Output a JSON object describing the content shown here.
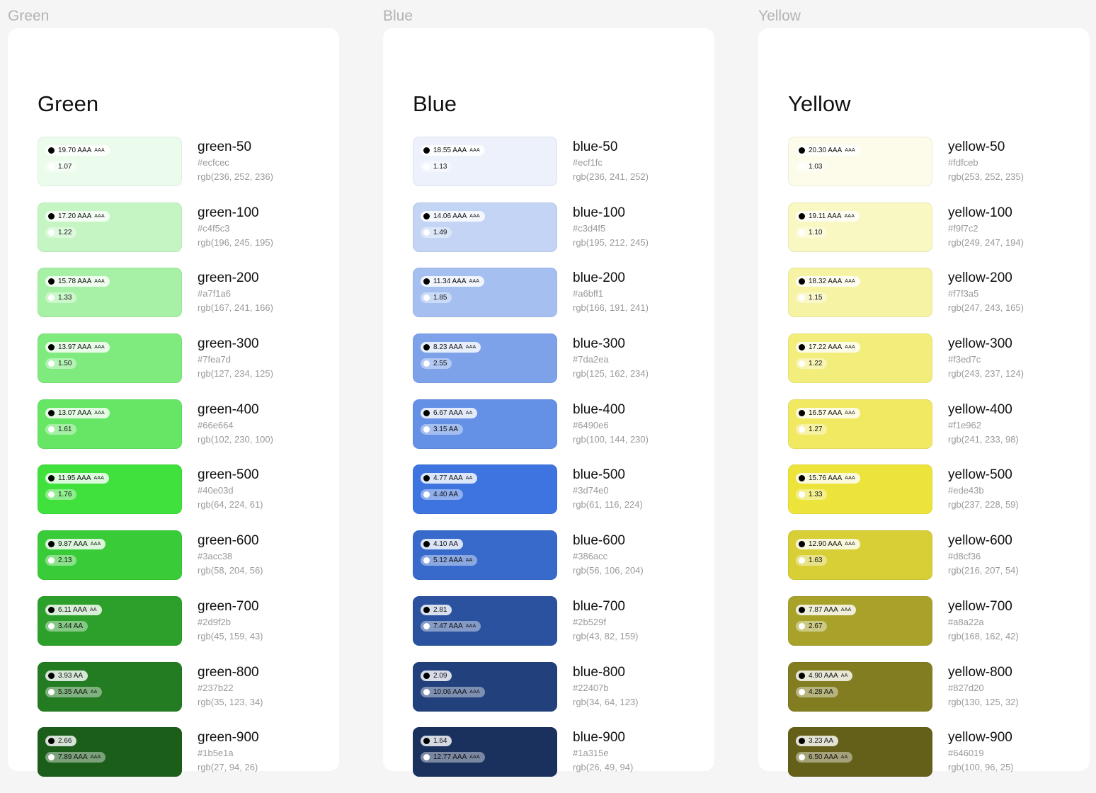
{
  "palettes": [
    {
      "frame_label": "Green",
      "title": "Green",
      "swatches": [
        {
          "name": "green-50",
          "hex": "#ecfcec",
          "rgb": "rgb(236, 252, 236)",
          "dark_ratio": "19.70 AAA",
          "dark_grade": "AAA",
          "light_ratio": "1.07",
          "light_grade": ""
        },
        {
          "name": "green-100",
          "hex": "#c4f5c3",
          "rgb": "rgb(196, 245, 195)",
          "dark_ratio": "17.20 AAA",
          "dark_grade": "AAA",
          "light_ratio": "1.22",
          "light_grade": ""
        },
        {
          "name": "green-200",
          "hex": "#a7f1a6",
          "rgb": "rgb(167, 241, 166)",
          "dark_ratio": "15.78 AAA",
          "dark_grade": "AAA",
          "light_ratio": "1.33",
          "light_grade": ""
        },
        {
          "name": "green-300",
          "hex": "#7fea7d",
          "rgb": "rgb(127, 234, 125)",
          "dark_ratio": "13.97 AAA",
          "dark_grade": "AAA",
          "light_ratio": "1.50",
          "light_grade": ""
        },
        {
          "name": "green-400",
          "hex": "#66e664",
          "rgb": "rgb(102, 230, 100)",
          "dark_ratio": "13.07 AAA",
          "dark_grade": "AAA",
          "light_ratio": "1.61",
          "light_grade": ""
        },
        {
          "name": "green-500",
          "hex": "#40e03d",
          "rgb": "rgb(64, 224, 61)",
          "dark_ratio": "11.95 AAA",
          "dark_grade": "AAA",
          "light_ratio": "1.76",
          "light_grade": ""
        },
        {
          "name": "green-600",
          "hex": "#3acc38",
          "rgb": "rgb(58, 204, 56)",
          "dark_ratio": "9.87 AAA",
          "dark_grade": "AAA",
          "light_ratio": "2.13",
          "light_grade": ""
        },
        {
          "name": "green-700",
          "hex": "#2d9f2b",
          "rgb": "rgb(45, 159, 43)",
          "dark_ratio": "6.11 AAA",
          "dark_grade": "AA",
          "light_ratio": "3.44 AA",
          "light_grade": ""
        },
        {
          "name": "green-800",
          "hex": "#237b22",
          "rgb": "rgb(35, 123, 34)",
          "dark_ratio": "3.93 AA",
          "dark_grade": "",
          "light_ratio": "5.35 AAA",
          "light_grade": "AA"
        },
        {
          "name": "green-900",
          "hex": "#1b5e1a",
          "rgb": "rgb(27, 94, 26)",
          "dark_ratio": "2.66",
          "dark_grade": "",
          "light_ratio": "7.89 AAA",
          "light_grade": "AAA"
        }
      ]
    },
    {
      "frame_label": "Blue",
      "title": "Blue",
      "swatches": [
        {
          "name": "blue-50",
          "hex": "#ecf1fc",
          "rgb": "rgb(236, 241, 252)",
          "dark_ratio": "18.55 AAA",
          "dark_grade": "AAA",
          "light_ratio": "1.13",
          "light_grade": ""
        },
        {
          "name": "blue-100",
          "hex": "#c3d4f5",
          "rgb": "rgb(195, 212, 245)",
          "dark_ratio": "14.06 AAA",
          "dark_grade": "AAA",
          "light_ratio": "1.49",
          "light_grade": ""
        },
        {
          "name": "blue-200",
          "hex": "#a6bff1",
          "rgb": "rgb(166, 191, 241)",
          "dark_ratio": "11.34 AAA",
          "dark_grade": "AAA",
          "light_ratio": "1.85",
          "light_grade": ""
        },
        {
          "name": "blue-300",
          "hex": "#7da2ea",
          "rgb": "rgb(125, 162, 234)",
          "dark_ratio": "8.23 AAA",
          "dark_grade": "AAA",
          "light_ratio": "2.55",
          "light_grade": ""
        },
        {
          "name": "blue-400",
          "hex": "#6490e6",
          "rgb": "rgb(100, 144, 230)",
          "dark_ratio": "6.67 AAA",
          "dark_grade": "AA",
          "light_ratio": "3.15 AA",
          "light_grade": ""
        },
        {
          "name": "blue-500",
          "hex": "#3d74e0",
          "rgb": "rgb(61, 116, 224)",
          "dark_ratio": "4.77 AAA",
          "dark_grade": "AA",
          "light_ratio": "4.40 AA",
          "light_grade": ""
        },
        {
          "name": "blue-600",
          "hex": "#386acc",
          "rgb": "rgb(56, 106, 204)",
          "dark_ratio": "4.10 AA",
          "dark_grade": "",
          "light_ratio": "5.12 AAA",
          "light_grade": "AA"
        },
        {
          "name": "blue-700",
          "hex": "#2b529f",
          "rgb": "rgb(43, 82, 159)",
          "dark_ratio": "2.81",
          "dark_grade": "",
          "light_ratio": "7.47 AAA",
          "light_grade": "AAA"
        },
        {
          "name": "blue-800",
          "hex": "#22407b",
          "rgb": "rgb(34, 64, 123)",
          "dark_ratio": "2.09",
          "dark_grade": "",
          "light_ratio": "10.06 AAA",
          "light_grade": "AAA"
        },
        {
          "name": "blue-900",
          "hex": "#1a315e",
          "rgb": "rgb(26, 49, 94)",
          "dark_ratio": "1.64",
          "dark_grade": "",
          "light_ratio": "12.77 AAA",
          "light_grade": "AAA"
        }
      ]
    },
    {
      "frame_label": "Yellow",
      "title": "Yellow",
      "swatches": [
        {
          "name": "yellow-50",
          "hex": "#fdfceb",
          "rgb": "rgb(253, 252, 235)",
          "dark_ratio": "20.30 AAA",
          "dark_grade": "AAA",
          "light_ratio": "1.03",
          "light_grade": ""
        },
        {
          "name": "yellow-100",
          "hex": "#f9f7c2",
          "rgb": "rgb(249, 247, 194)",
          "dark_ratio": "19.11 AAA",
          "dark_grade": "AAA",
          "light_ratio": "1.10",
          "light_grade": ""
        },
        {
          "name": "yellow-200",
          "hex": "#f7f3a5",
          "rgb": "rgb(247, 243, 165)",
          "dark_ratio": "18.32 AAA",
          "dark_grade": "AAA",
          "light_ratio": "1.15",
          "light_grade": ""
        },
        {
          "name": "yellow-300",
          "hex": "#f3ed7c",
          "rgb": "rgb(243, 237, 124)",
          "dark_ratio": "17.22 AAA",
          "dark_grade": "AAA",
          "light_ratio": "1.22",
          "light_grade": ""
        },
        {
          "name": "yellow-400",
          "hex": "#f1e962",
          "rgb": "rgb(241, 233, 98)",
          "dark_ratio": "16.57 AAA",
          "dark_grade": "AAA",
          "light_ratio": "1.27",
          "light_grade": ""
        },
        {
          "name": "yellow-500",
          "hex": "#ede43b",
          "rgb": "rgb(237, 228, 59)",
          "dark_ratio": "15.76 AAA",
          "dark_grade": "AAA",
          "light_ratio": "1.33",
          "light_grade": ""
        },
        {
          "name": "yellow-600",
          "hex": "#d8cf36",
          "rgb": "rgb(216, 207, 54)",
          "dark_ratio": "12.90 AAA",
          "dark_grade": "AAA",
          "light_ratio": "1.63",
          "light_grade": ""
        },
        {
          "name": "yellow-700",
          "hex": "#a8a22a",
          "rgb": "rgb(168, 162, 42)",
          "dark_ratio": "7.87 AAA",
          "dark_grade": "AAA",
          "light_ratio": "2.67",
          "light_grade": ""
        },
        {
          "name": "yellow-800",
          "hex": "#827d20",
          "rgb": "rgb(130, 125, 32)",
          "dark_ratio": "4.90 AAA",
          "dark_grade": "AA",
          "light_ratio": "4.28 AA",
          "light_grade": ""
        },
        {
          "name": "yellow-900",
          "hex": "#646019",
          "rgb": "rgb(100, 96, 25)",
          "dark_ratio": "3.23 AA",
          "dark_grade": "",
          "light_ratio": "6.50 AAA",
          "light_grade": "AA"
        }
      ]
    }
  ]
}
